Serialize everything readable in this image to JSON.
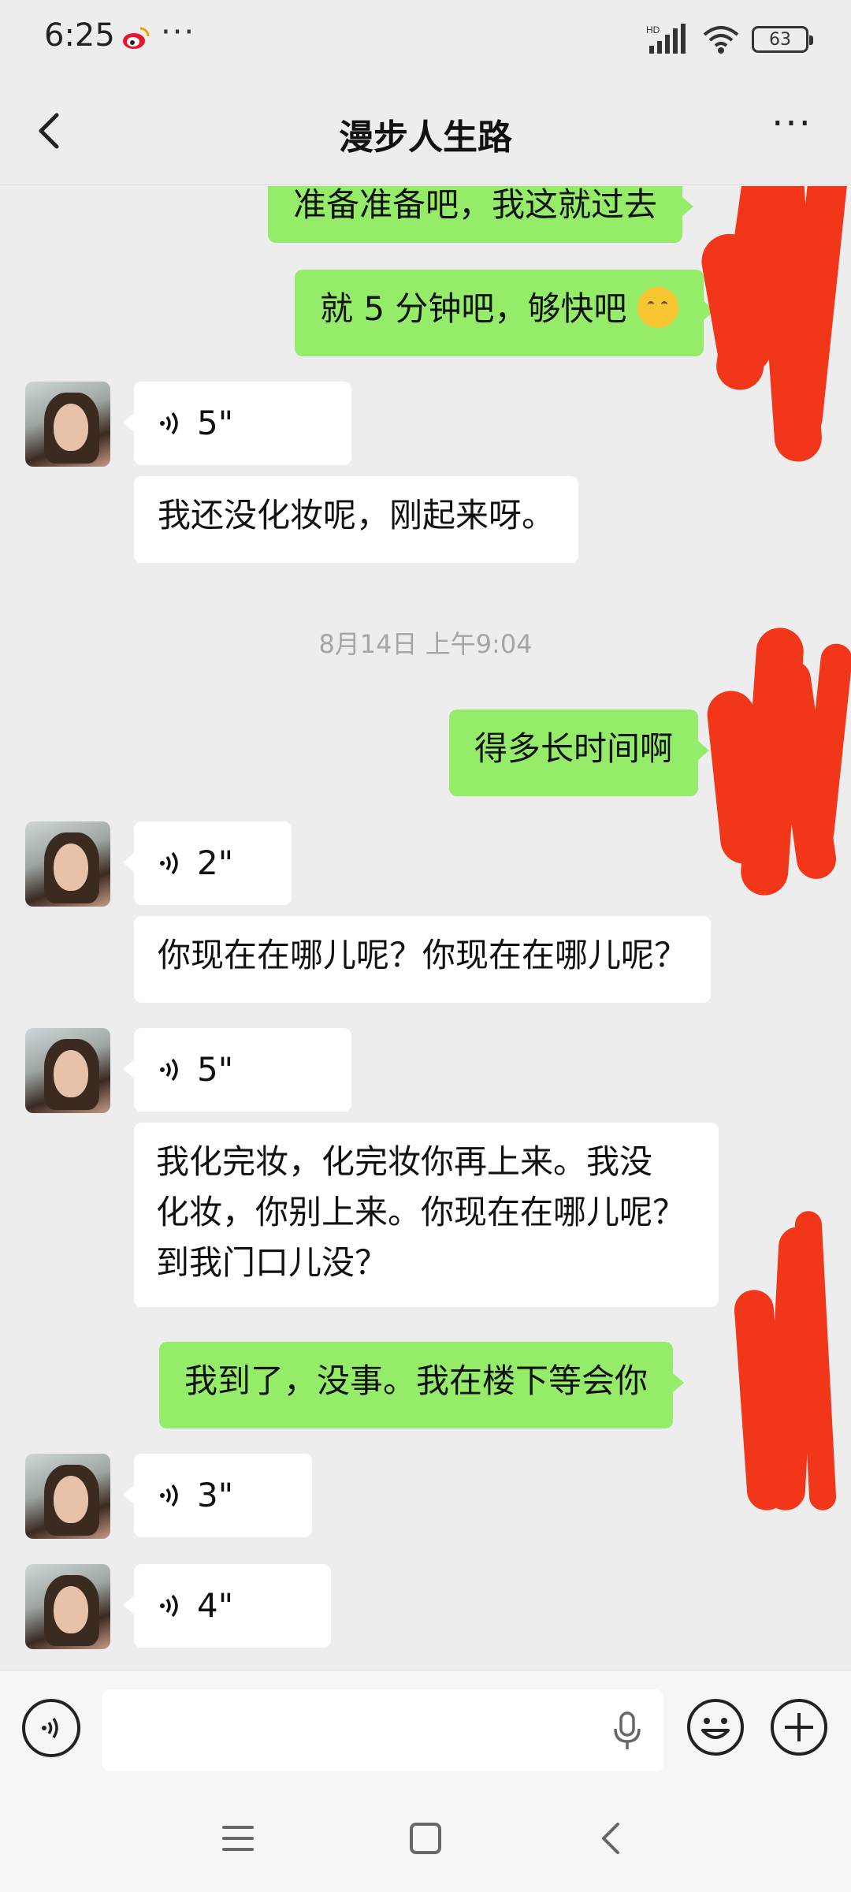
{
  "status_bar": {
    "time": "6:25",
    "weibo_icon": "weibo-icon",
    "more_dots": "···",
    "network_label": "HD",
    "battery": "63"
  },
  "header": {
    "title": "漫步人生路",
    "back_icon": "chevron-left-icon",
    "more_icon": "more-dots-icon"
  },
  "messages": [
    {
      "side": "out",
      "type": "text",
      "text": "准备准备吧，我这就过去"
    },
    {
      "side": "out",
      "type": "text",
      "text": "就 5 分钟吧，够快吧",
      "emoji": "thinking-face-emoji"
    },
    {
      "side": "in",
      "type": "voice",
      "duration": "5\""
    },
    {
      "side": "in",
      "type": "text",
      "text": "我还没化妆呢，刚起来呀。"
    },
    {
      "side": "system",
      "type": "timestamp",
      "text": "8月14日 上午9:04"
    },
    {
      "side": "out",
      "type": "text",
      "text": "得多长时间啊"
    },
    {
      "side": "in",
      "type": "voice",
      "duration": "2\""
    },
    {
      "side": "in",
      "type": "text",
      "text": "你现在在哪儿呢？你现在在哪儿呢？"
    },
    {
      "side": "in",
      "type": "voice",
      "duration": "5\""
    },
    {
      "side": "in",
      "type": "text",
      "lines": [
        "我化完妆，化完妆你再上来。我没",
        "化妆，你别上来。你现在在哪儿呢？",
        "到我门口儿没？"
      ]
    },
    {
      "side": "out",
      "type": "text",
      "text": "我到了，没事。我在楼下等会你"
    },
    {
      "side": "in",
      "type": "voice",
      "duration": "3\""
    },
    {
      "side": "in",
      "type": "voice",
      "duration": "4\""
    }
  ],
  "input_bar": {
    "voice_toggle_icon": "voice-toggle-icon",
    "mic_icon": "microphone-icon",
    "emoji_icon": "emoji-icon",
    "plus_icon": "plus-icon"
  },
  "nav_bar": {
    "menu_icon": "menu-icon",
    "home_icon": "home-square-icon",
    "back_icon": "back-triangle-icon"
  },
  "colors": {
    "outgoing_bubble": "#95ec69",
    "incoming_bubble": "#ffffff",
    "chat_background": "#ededed",
    "redaction": "#f2361a"
  }
}
